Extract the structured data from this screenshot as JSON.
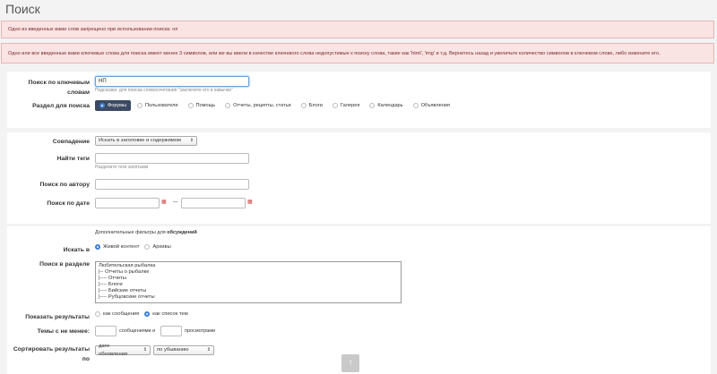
{
  "title": "Поиск",
  "errors": [
    "Одно из введенных вами слов запрещено при использовании поиска: нп",
    "Одно или все введенные вами ключевые слова для поиска имеет менее 3 символов, или же вы ввели в качестве ключевого слова недопустимые к поиску слова, такие как 'html', 'img' и т.д. Вернитесь назад и увеличьте количество символов в ключевом слове, либо измените его."
  ],
  "keywords": {
    "label": "Поиск по ключевым словам",
    "value": "НП",
    "hint": "Подсказка: для поиска словосочетания \"заключите его в кавычки\""
  },
  "section": {
    "label": "Раздел для поиска",
    "tabs": [
      "Форумы",
      "Пользователи",
      "Помощь",
      "Отчеты, рецепты, статьи",
      "Блоги",
      "Галерея",
      "Календарь",
      "Объявления"
    ],
    "active": 0
  },
  "match": {
    "label": "Совпадение",
    "value": "Искать в заголовке и содержимом"
  },
  "tags": {
    "label": "Найти теги",
    "value": "",
    "hint": "Разделите теги запятыми"
  },
  "author": {
    "label": "Поиск по автору",
    "value": ""
  },
  "date": {
    "label": "Поиск по дате",
    "separator": "—"
  },
  "extra": {
    "prefix": "Дополнительные фильтры для",
    "bold": "обсуждений"
  },
  "search_in": {
    "label": "Искать в",
    "options": [
      "Живой контент",
      "Архивы"
    ],
    "selected": 0
  },
  "search_section": {
    "label": "Поиск в разделе",
    "items": [
      "Любительская рыбалка",
      "|-- Отчеты о рыбалке",
      "|---- Отчеты",
      "|---- Блоги",
      "|---- Бийские отчеты",
      "|---- Рубцовские отчеты"
    ]
  },
  "show_results": {
    "label": "Показать результаты",
    "options": [
      "как сообщения",
      "как список тем"
    ],
    "selected": 1
  },
  "min_topics": {
    "label": "Темы с не менее:",
    "posts_label": "сообщениями и",
    "views_label": "просмотрами"
  },
  "sort": {
    "label": "Сортировать результаты по",
    "by": "дате обновления",
    "order": "по убыванию"
  },
  "scroll_top": "↑"
}
